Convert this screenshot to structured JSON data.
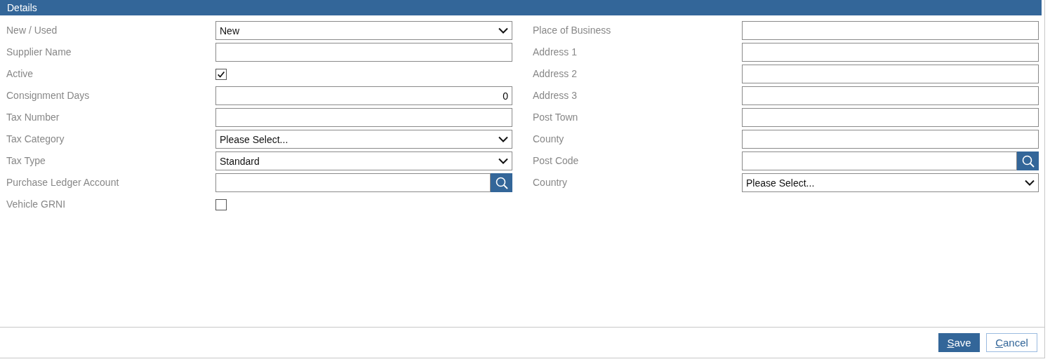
{
  "panel": {
    "title": "Details"
  },
  "left_fields": [
    {
      "label": "New / Used",
      "kind": "select",
      "value": "New"
    },
    {
      "label": "Supplier Name",
      "kind": "text"
    },
    {
      "label": "Active",
      "kind": "checkbox",
      "checked": true
    },
    {
      "label": "Consignment Days",
      "kind": "number",
      "value": "0"
    },
    {
      "label": "Tax Number",
      "kind": "text"
    },
    {
      "label": "Tax Category",
      "kind": "select",
      "value": "Please Select..."
    },
    {
      "label": "Tax Type",
      "kind": "select",
      "value": "Standard"
    },
    {
      "label": "Purchase Ledger Account",
      "kind": "lookup"
    },
    {
      "label": "Vehicle GRNI",
      "kind": "checkbox",
      "checked": false
    }
  ],
  "right_fields": [
    {
      "label": "Place of Business",
      "kind": "text"
    },
    {
      "label": "Address 1",
      "kind": "text"
    },
    {
      "label": "Address 2",
      "kind": "text"
    },
    {
      "label": "Address 3",
      "kind": "text"
    },
    {
      "label": "Post Town",
      "kind": "text"
    },
    {
      "label": "County",
      "kind": "text"
    },
    {
      "label": "Post Code",
      "kind": "lookup"
    },
    {
      "label": "Country",
      "kind": "select",
      "value": "Please Select..."
    }
  ],
  "buttons": [
    {
      "label": "Save",
      "kind": "primary",
      "access_key_underlined": true
    },
    {
      "label": "Cancel",
      "kind": "secondary",
      "access_key_underlined": true
    }
  ]
}
